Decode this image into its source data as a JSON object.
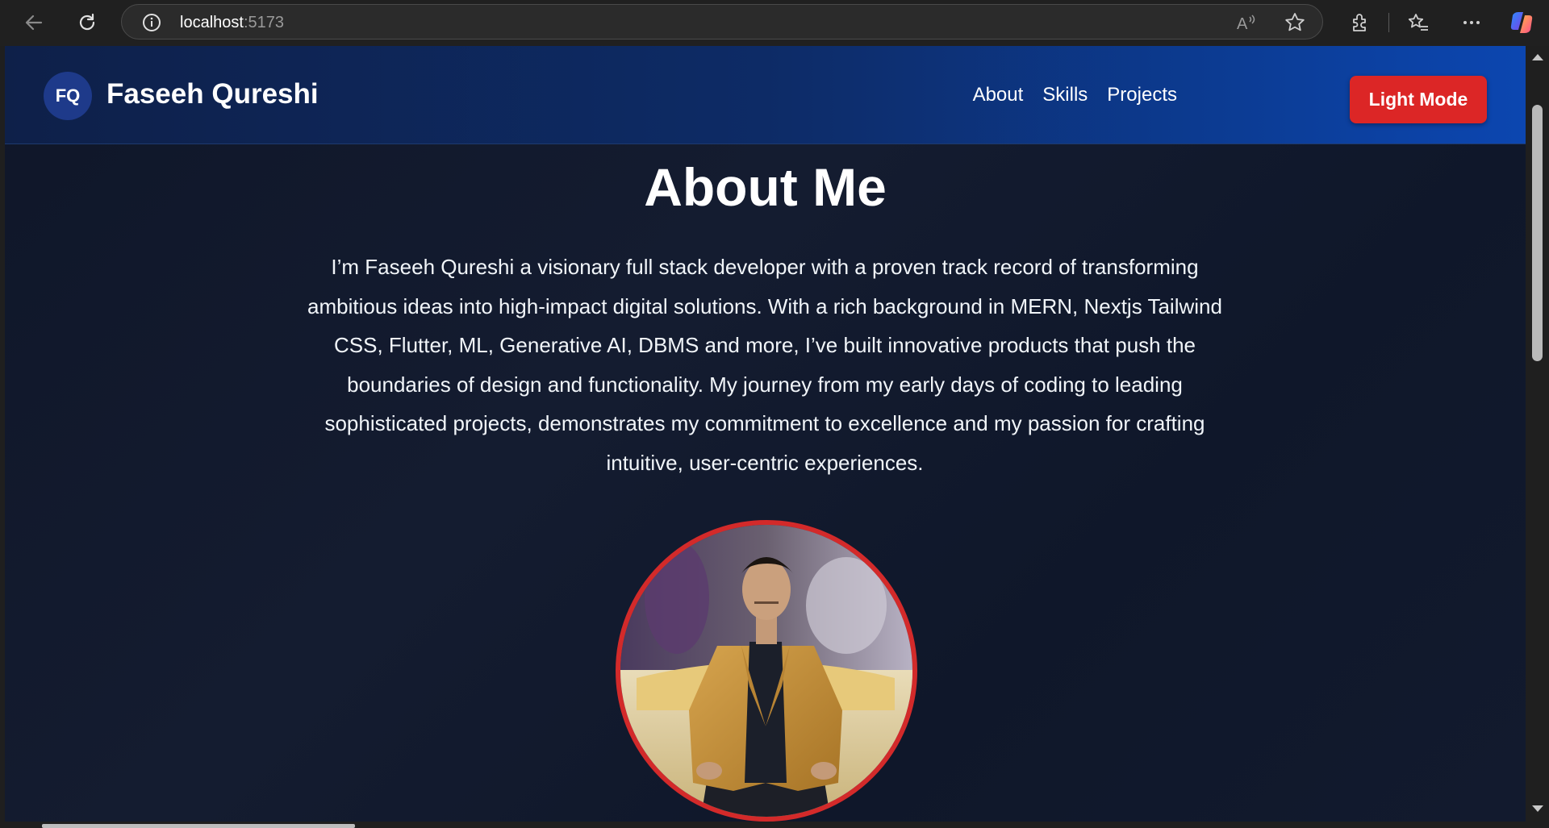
{
  "browser": {
    "url_host": "localhost",
    "url_port": ":5173",
    "icons": [
      "back-icon",
      "reload-icon",
      "site-info-icon",
      "read-aloud-icon",
      "favorite-star-icon",
      "extensions-icon",
      "favorites-icon",
      "more-icon",
      "copilot-icon"
    ]
  },
  "navbar": {
    "logo_initials": "FQ",
    "brand_name": "Faseeh Qureshi",
    "links": [
      "About",
      "Skills",
      "Projects"
    ],
    "mode_button": "Light Mode"
  },
  "about": {
    "title": "About Me",
    "paragraph": "I’m Faseeh Qureshi a visionary full stack developer with a proven track record of transforming ambitious ideas into high-impact digital solutions. With a rich background in MERN, Nextjs Tailwind CSS, Flutter, ML, Generative AI, DBMS and more, I’ve built innovative products that push the boundaries of design and functionality. My journey from my early days of coding to leading sophisticated projects, demonstrates my commitment to excellence and my passion for crafting intuitive, user-centric experiences."
  },
  "colors": {
    "accent_red": "#dc2626",
    "navbar_dark": "#0e2049",
    "navbar_blue": "#0c46b0",
    "page_bg": "#0f172a"
  }
}
